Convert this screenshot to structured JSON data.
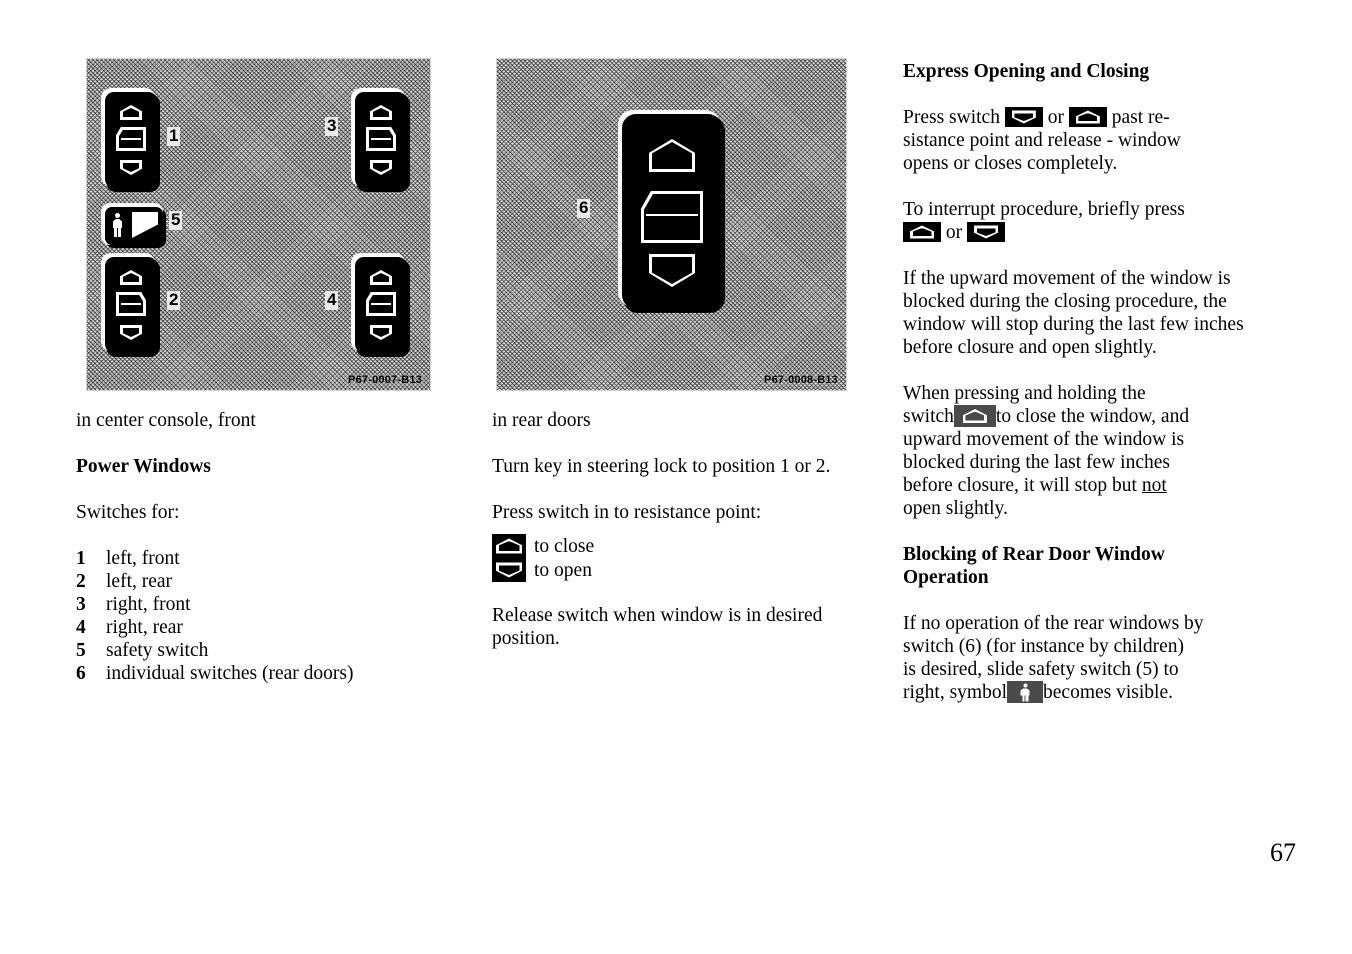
{
  "page": {
    "number": "67"
  },
  "figures": {
    "left": {
      "code": "P67-0007-B13",
      "caption": "in center console, front",
      "callouts": [
        "1",
        "2",
        "3",
        "4",
        "5"
      ]
    },
    "middle": {
      "code": "P67-0008-B13",
      "caption": "in rear doors",
      "callouts": [
        "6"
      ]
    }
  },
  "left_column": {
    "caption": "in center console, front",
    "heading": "Power Windows",
    "intro": "Switches for:",
    "items": [
      {
        "num": "1",
        "label": "left, front"
      },
      {
        "num": "2",
        "label": "left, rear"
      },
      {
        "num": "3",
        "label": "right, front"
      },
      {
        "num": "4",
        "label": "right, rear"
      },
      {
        "num": "5",
        "label": "safety switch"
      },
      {
        "num": "6",
        "label": "individual switches (rear doors)"
      }
    ]
  },
  "middle_column": {
    "caption": "in rear doors",
    "para_key": "Turn key in steering lock to position 1 or 2.",
    "para_press": "Press switch in to resistance point:",
    "legend": [
      {
        "icon": "switch-up-icon",
        "label": "to close"
      },
      {
        "icon": "switch-down-icon",
        "label": "to  open"
      }
    ],
    "para_release": "Release switch when window is in desired position."
  },
  "right_column": {
    "heading_express": "Express Opening and Closing",
    "press_switch": {
      "before": "Press switch ",
      "icon_a": "switch-down-icon",
      "between": " or ",
      "icon_b": "switch-up-icon",
      "after": " past re-",
      "line2": "sistance point and release - window",
      "line3": "opens or closes completely."
    },
    "interrupt": {
      "line1": "To interrupt procedure, briefly press",
      "icon_a": "switch-up-icon",
      "between": " or ",
      "icon_b": "switch-down-icon"
    },
    "blocked_para": "If the upward movement of the window is blocked during the closing procedure, the window will stop during the last few inches before closure and open slightly.",
    "holding": {
      "line1": "When pressing and holding the",
      "line2_before": "switch",
      "icon": "switch-up-icon",
      "line2_after": "to close the window, and",
      "line3": "upward movement of the window is",
      "line4": "blocked during the last few inches",
      "line5_before": "before closure, it will stop but ",
      "line5_underlined": "not",
      "line6": "open slightly."
    },
    "heading_blocking_l1": "Blocking of Rear Door Window",
    "heading_blocking_l2": "Operation",
    "blocking": {
      "line1": "If no operation of the rear windows by",
      "line2": "switch (6) (for instance by children)",
      "line3": "is desired, slide safety switch (5) to",
      "line4_before": "right, symbol",
      "icon": "child-safety-icon",
      "line4_after": "becomes visible."
    }
  }
}
